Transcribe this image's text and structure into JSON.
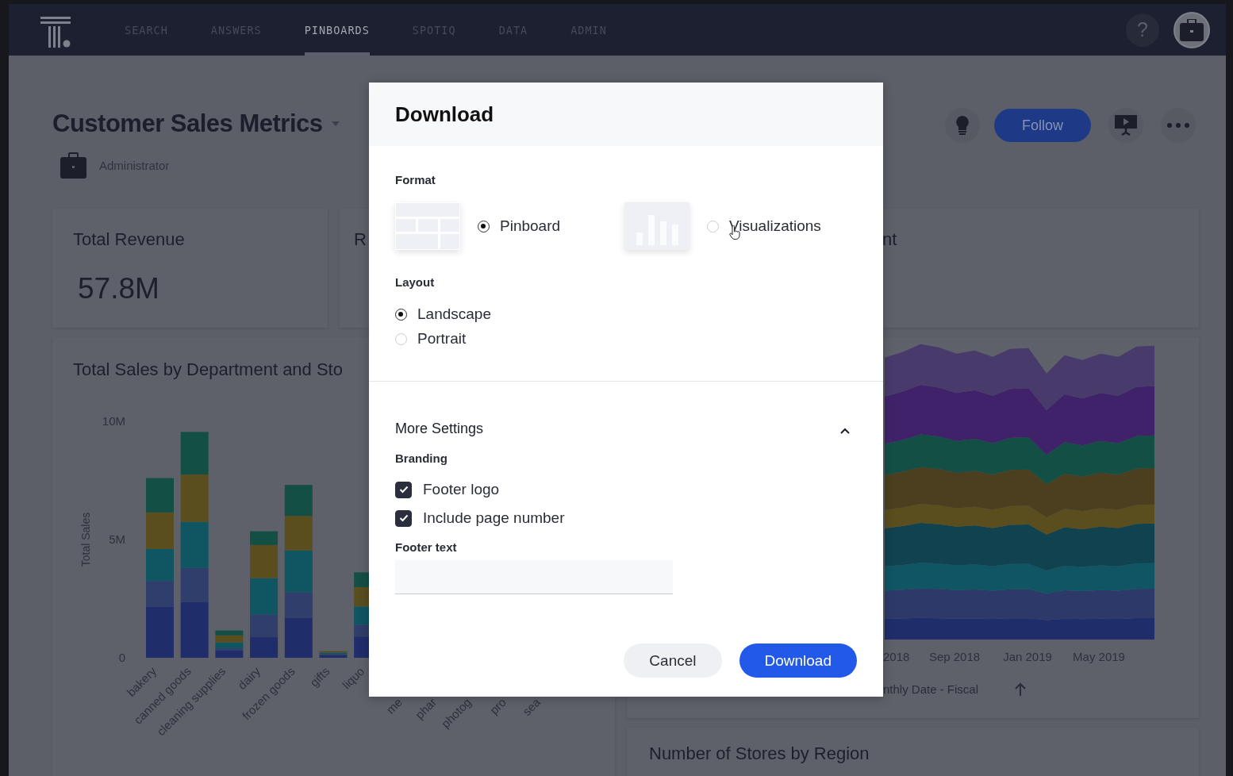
{
  "nav": {
    "items": [
      {
        "label": "SEARCH",
        "selected": false
      },
      {
        "label": "ANSWERS",
        "selected": false
      },
      {
        "label": "PINBOARDS",
        "selected": true
      },
      {
        "label": "SPOTIQ",
        "selected": false
      },
      {
        "label": "DATA",
        "selected": false
      },
      {
        "label": "ADMIN",
        "selected": false
      }
    ],
    "help": "?"
  },
  "pinboard": {
    "title": "Customer Sales Metrics",
    "owner": "Administrator",
    "follow_button": "Follow"
  },
  "kpis": [
    {
      "label": "Total Revenue",
      "value": "57.8M"
    },
    {
      "label": "R"
    },
    {
      "label": "nt"
    }
  ],
  "sales_chart": {
    "chart_data": {
      "type": "bar",
      "title": "Total Sales by Department and Sto",
      "ylabel": "Total Sales",
      "stacked": true,
      "ylim": [
        0,
        10
      ],
      "yticks": [
        {
          "value": 0,
          "label": "0"
        },
        {
          "value": 5,
          "label": "5M"
        },
        {
          "value": 10,
          "label": "10M"
        }
      ],
      "categories": [
        "bakery",
        "canned goods",
        "cleaning supplies",
        "dairy",
        "frozen goods",
        "gifts",
        "liquo"
      ],
      "series": [
        {
          "color": "#1f2d6b",
          "values": [
            2.15,
            2.35,
            0.3,
            0.87,
            1.68,
            0.1,
            0.9
          ]
        },
        {
          "color": "#2f3e6a",
          "values": [
            1.1,
            1.45,
            0.1,
            0.95,
            1.09,
            0.06,
            0.5
          ]
        },
        {
          "color": "#0f5562",
          "values": [
            1.35,
            1.95,
            0.25,
            1.55,
            1.77,
            0.06,
            0.77
          ]
        },
        {
          "color": "#5a4e1f",
          "values": [
            1.55,
            2.0,
            0.3,
            1.4,
            1.46,
            0.06,
            0.82
          ]
        },
        {
          "color": "#134f45",
          "values": [
            1.45,
            1.8,
            0.2,
            0.58,
            1.31,
            null,
            0.62
          ]
        }
      ]
    },
    "cut_axis_labels": [
      "me",
      "phar",
      "photog",
      "pro",
      "sea"
    ]
  },
  "trend_chart": {
    "x_labels": [
      "2018",
      "Sep 2018",
      "Jan 2019",
      "May 2019"
    ],
    "x_axis_title": "nthly Date - Fiscal"
  },
  "stores_card": {
    "title": "Number of Stores by Region"
  },
  "dialog": {
    "title": "Download",
    "format": {
      "label": "Format",
      "options": [
        {
          "kind": "pinboard",
          "label": "Pinboard",
          "selected": true
        },
        {
          "kind": "visualizations",
          "label": "Visualizations",
          "selected": false
        }
      ]
    },
    "layout": {
      "label": "Layout",
      "options": [
        {
          "label": "Landscape",
          "selected": true
        },
        {
          "label": "Portrait",
          "selected": false
        }
      ]
    },
    "more_settings": {
      "label": "More Settings",
      "expanded": true,
      "branding_label": "Branding",
      "checkboxes": [
        {
          "label": "Footer logo",
          "checked": true
        },
        {
          "label": "Include page number",
          "checked": true
        }
      ],
      "footer_text_label": "Footer text"
    },
    "buttons": [
      {
        "kind": "secondary",
        "label": "Cancel"
      },
      {
        "kind": "primary",
        "label": "Download"
      }
    ]
  }
}
